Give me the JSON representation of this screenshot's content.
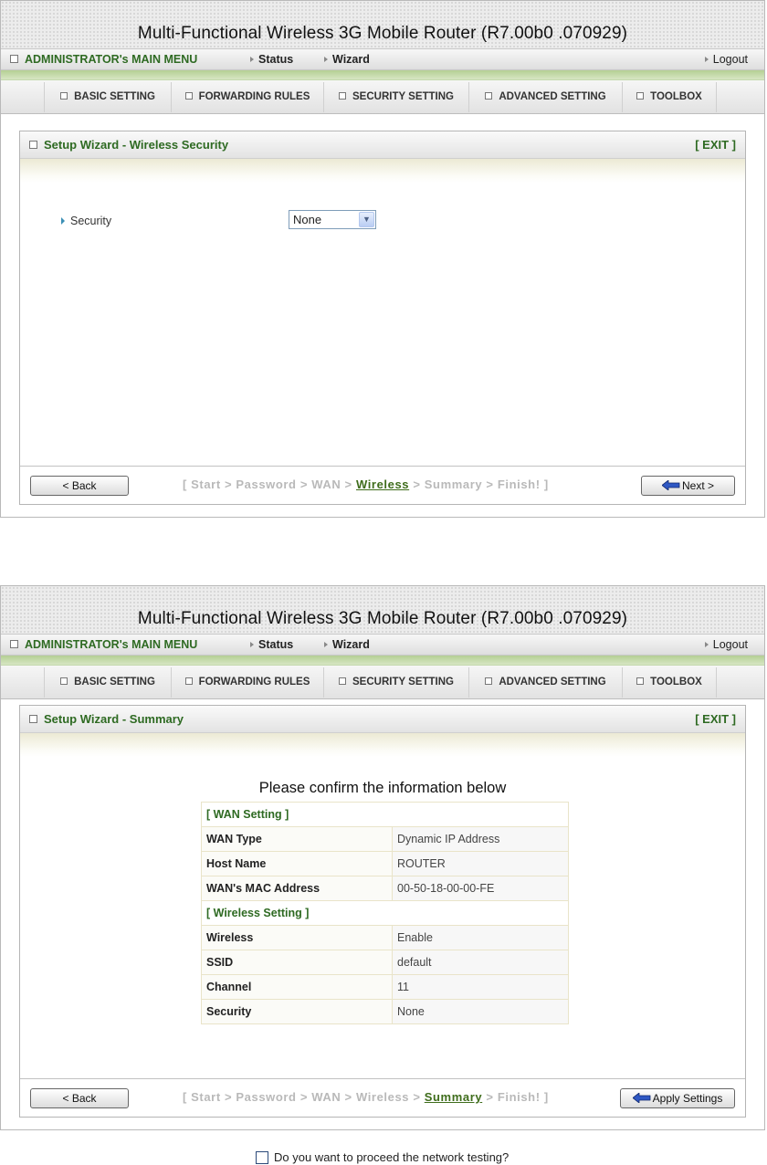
{
  "app": {
    "title": "Multi-Functional Wireless 3G Mobile Router (R7.00b0 .070929)",
    "menu": {
      "admin": "ADMINISTRATOR's MAIN MENU",
      "status": "Status",
      "wizard": "Wizard",
      "logout": "Logout"
    },
    "tabs": [
      "BASIC SETTING",
      "FORWARDING RULES",
      "SECURITY SETTING",
      "ADVANCED SETTING",
      "TOOLBOX"
    ]
  },
  "screen1": {
    "panel_title": "Setup Wizard - Wireless Security",
    "exit": "[ EXIT ]",
    "security_label": "Security",
    "security_value": "None",
    "back": "< Back",
    "next": "Next >",
    "crumb": {
      "open": "[ ",
      "pre": "Start > Password > WAN > ",
      "current": "Wireless",
      "post": " > Summary > Finish! ]"
    }
  },
  "screen2": {
    "panel_title": "Setup Wizard - Summary",
    "exit": "[ EXIT ]",
    "confirm_title": "Please confirm the information below",
    "wan_header": "[ WAN Setting ]",
    "wan_rows": [
      {
        "k": "WAN Type",
        "v": "Dynamic IP Address"
      },
      {
        "k": "Host Name",
        "v": "ROUTER"
      },
      {
        "k": "WAN's MAC Address",
        "v": "00-50-18-00-00-FE"
      }
    ],
    "wireless_header": "[ Wireless Setting ]",
    "wireless_rows": [
      {
        "k": "Wireless",
        "v": "Enable"
      },
      {
        "k": "SSID",
        "v": "default"
      },
      {
        "k": "Channel",
        "v": "11"
      },
      {
        "k": "Security",
        "v": "None"
      }
    ],
    "checkbox_label": "Do you want to proceed the network testing?",
    "back": "< Back",
    "apply": "Apply Settings",
    "crumb": {
      "open": "[ ",
      "pre": "Start > Password > WAN > Wireless > ",
      "current": "Summary",
      "post": " > Finish! ]"
    }
  }
}
